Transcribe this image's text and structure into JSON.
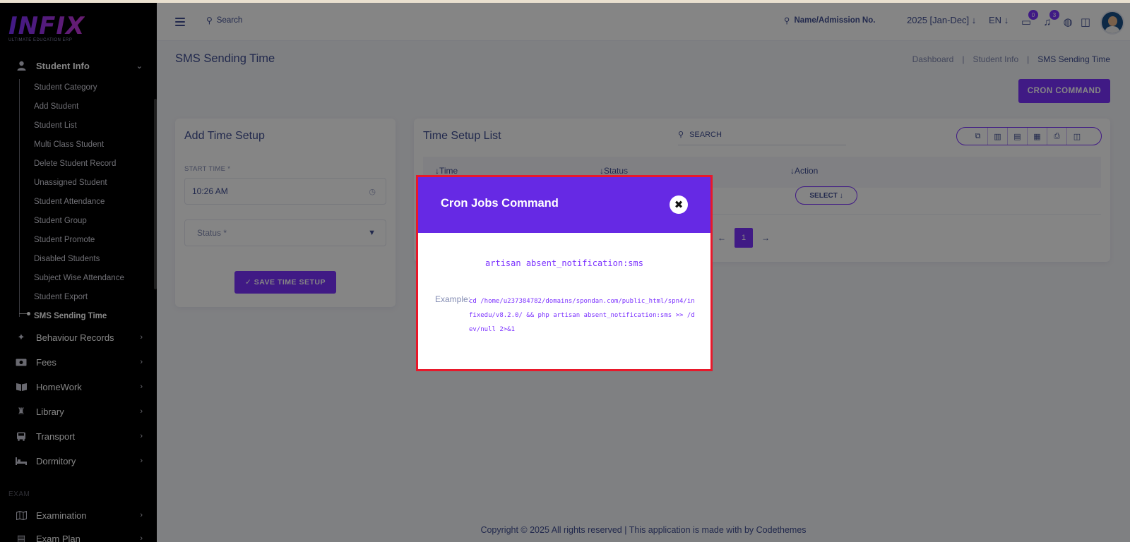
{
  "brand": {
    "logo": "INFIX",
    "tagline": "ULTIMATE EDUCATION ERP"
  },
  "sidebar": {
    "student_info": {
      "label": "Student Info",
      "icon": "user-icon"
    },
    "sub_items": [
      "Student Category",
      "Add Student",
      "Student List",
      "Multi Class Student",
      "Delete Student Record",
      "Unassigned Student",
      "Student Attendance",
      "Student Group",
      "Student Promote",
      "Disabled Students",
      "Subject Wise Attendance",
      "Student Export",
      "SMS Sending Time"
    ],
    "modules": [
      {
        "label": "Behaviour Records",
        "icon": "puzzle-icon"
      },
      {
        "label": "Fees",
        "icon": "money-icon"
      },
      {
        "label": "HomeWork",
        "icon": "book-icon"
      },
      {
        "label": "Library",
        "icon": "library-icon"
      },
      {
        "label": "Transport",
        "icon": "bus-icon"
      },
      {
        "label": "Dormitory",
        "icon": "bed-icon"
      }
    ],
    "section_exam": "EXAM",
    "exam_items": [
      {
        "label": "Examination",
        "icon": "map-icon"
      },
      {
        "label": "Exam Plan",
        "icon": "plan-icon"
      }
    ]
  },
  "header": {
    "search_placeholder": "Search",
    "name_search": "Name/Admission No.",
    "session": "2025 [Jan-Dec]",
    "language": "EN",
    "messages_count": "0",
    "notifications_count": "3"
  },
  "page": {
    "title": "SMS Sending Time",
    "breadcrumb": [
      "Dashboard",
      "Student Info",
      "SMS Sending Time"
    ],
    "cron_button": "CRON COMMAND"
  },
  "add_form": {
    "title": "Add Time Setup",
    "start_time_label": "START TIME *",
    "start_time_value": "10:26 AM",
    "status_placeholder": "Status *",
    "save_button": "SAVE TIME SETUP"
  },
  "list": {
    "title": "Time Setup List",
    "search_placeholder": "SEARCH",
    "columns": [
      "Time",
      "Status",
      "Action"
    ],
    "select_button": "SELECT",
    "current_page": "1"
  },
  "modal": {
    "title": "Cron Jobs Command",
    "command": "artisan absent_notification:sms",
    "example_label": "Example:",
    "example_code": "cd /home/u237384782/domains/spondan.com/public_html/spn4/infixedu/v8.2.0/ && php artisan absent_notification:sms >> /dev/null 2>&1"
  },
  "footer": "Copyright © 2025 All rights reserved | This application is made with by Codethemes"
}
